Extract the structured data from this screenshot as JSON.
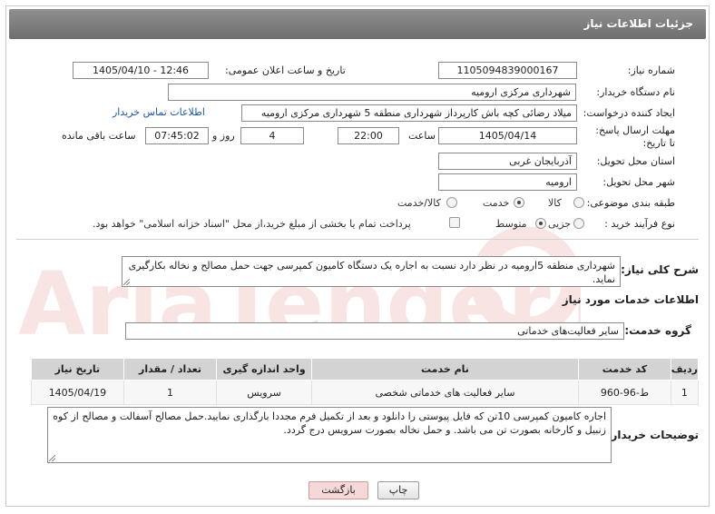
{
  "header": {
    "title": "جزئیات اطلاعات نیاز"
  },
  "fields": {
    "need_number_label": "شماره نیاز:",
    "need_number": "1105094839000167",
    "announce_label": "تاریخ و ساعت اعلان عمومی:",
    "announce_value": "1405/04/10 - 12:46",
    "buyer_org_label": "نام دستگاه خریدار:",
    "buyer_org": "شهرداری مرکزی ارومیه",
    "creator_label": "ایجاد کننده درخواست:",
    "creator": "میلاد رضائی کچه باش کارپرداز شهرداری منطقه 5 شهرداری مرکزی ارومیه",
    "contact_link": "اطلاعات تماس خریدار",
    "deadline_label": "مهلت ارسال پاسخ: تا تاریخ:",
    "deadline_date": "1405/04/14",
    "time_label": "ساعت",
    "deadline_time": "22:00",
    "days_value": "4",
    "days_label": "روز و",
    "remaining_time": "07:45:02",
    "remaining_label": "ساعت باقی مانده",
    "province_label": "استان محل تحویل:",
    "province": "آذربایجان غربی",
    "city_label": "شهر محل تحویل:",
    "city": "ارومیه",
    "category_label": "طبقه بندی موضوعی:",
    "category_options": [
      "کالا",
      "خدمت",
      "کالا/خدمت"
    ],
    "process_label": "نوع فرآیند خرید :",
    "process_options": [
      "جزیی",
      "متوسط"
    ],
    "payment_note": "پرداخت تمام یا بخشی از مبلغ خرید،از محل \"اسناد خزانه اسلامی\" خواهد بود."
  },
  "description": {
    "label": "شرح کلی نیاز:",
    "text": "شهرداری منطقه 5ارومیه در نظر دارد نسبت به اجاره یک دستگاه کامیون کمپرسی جهت حمل مصالح و نخاله بکارگیری نماید."
  },
  "services": {
    "section_title": "اطلاعات خدمات مورد نیاز",
    "group_label": "گروه خدمت:",
    "group_value": "سایر فعالیت‌های خدماتی",
    "columns": [
      "ردیف",
      "کد خدمت",
      "نام خدمت",
      "واحد اندازه گیری",
      "تعداد / مقدار",
      "تاریخ نیاز"
    ],
    "rows": [
      {
        "row": "1",
        "code": "ط-96-960",
        "name": "سایر فعالیت های خدماتی شخصی",
        "unit": "سرویس",
        "qty": "1",
        "date": "1405/04/19"
      }
    ]
  },
  "buyer_notes": {
    "label": "توضیحات خریدار:",
    "text": "اجاره کامیون کمپرسی 10تن که فایل پیوستی را دانلود و بعد از تکمیل فرم مجددا بارگذاری نمایید.حمل مصالح آسفالت و مصالح از کوه زنبیل  و کارخانه بصورت تن می باشد. و حمل نخاله بصورت سرویس درج گردد."
  },
  "buttons": {
    "print": "چاپ",
    "back": "بازگشت"
  },
  "watermark": {
    "text": "AriaTender.net"
  },
  "colors": {
    "header_bg": "#7f7f7f",
    "link": "#1a57b5",
    "back_button": "#f7d8d8",
    "table_header": "#d3d3d3"
  }
}
